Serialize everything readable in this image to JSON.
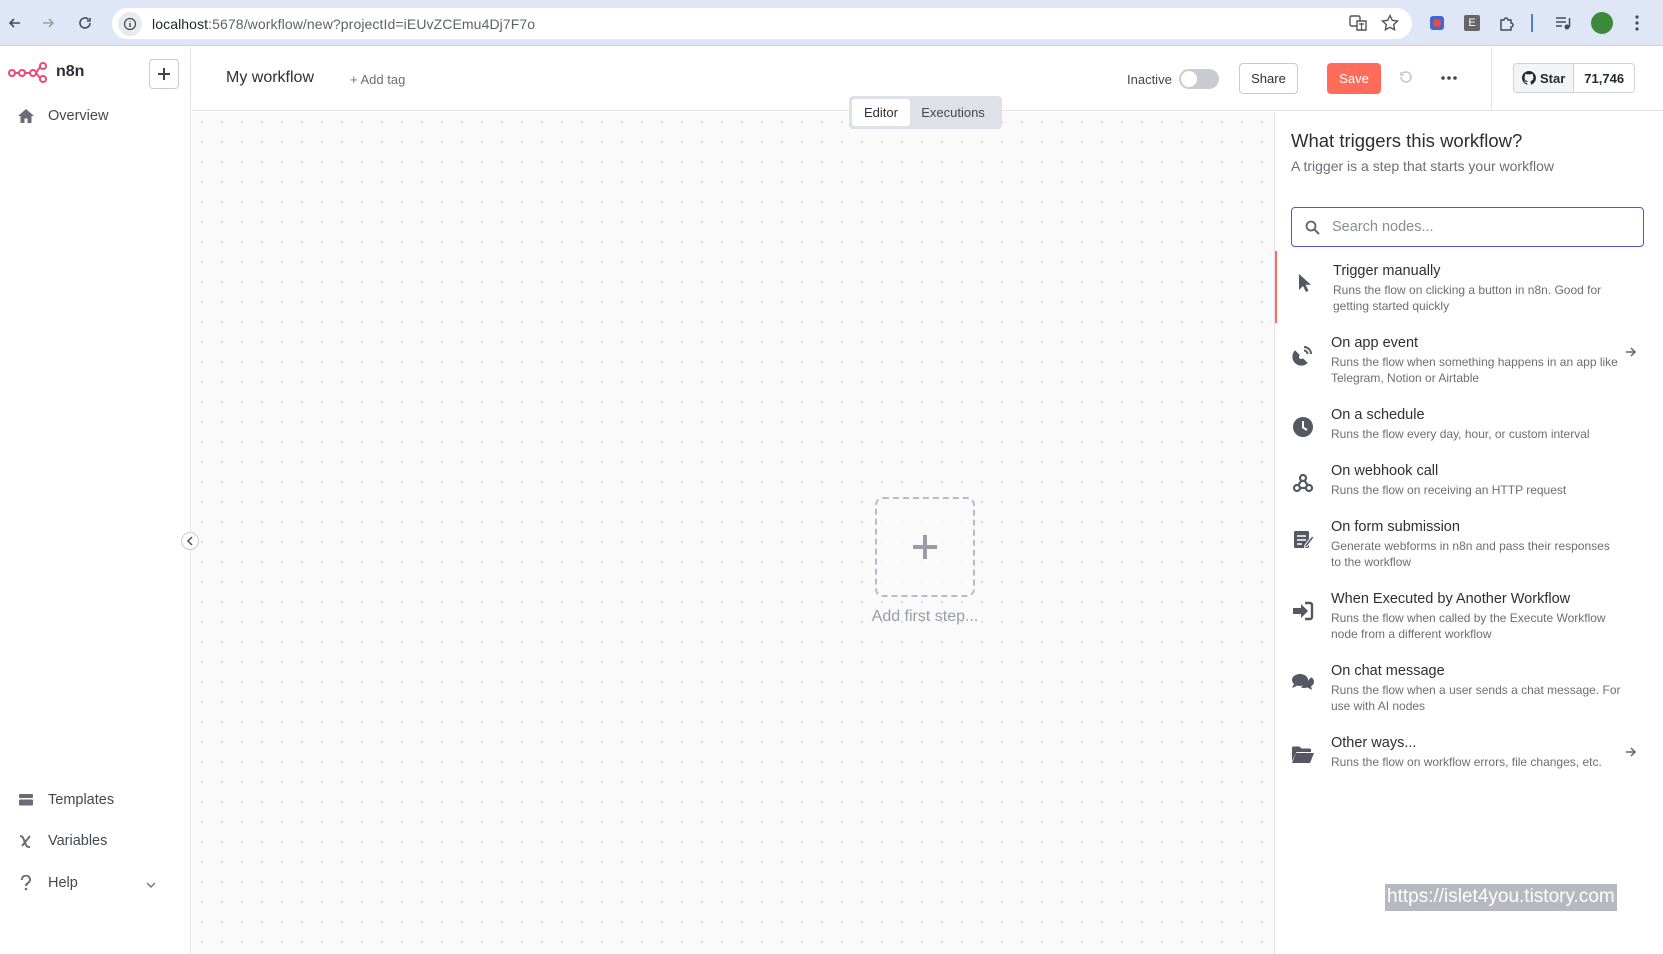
{
  "browser": {
    "url_host": "localhost",
    "url_rest": ":5678/workflow/new?projectId=iEUvZCEmu4Dj7F7o",
    "ext_e_label": "E"
  },
  "sidebar": {
    "logo_text": "n8n",
    "items_top": [
      {
        "label": "Overview",
        "icon": "home-icon"
      }
    ],
    "items_bottom": [
      {
        "label": "Templates",
        "icon": "templates-icon"
      },
      {
        "label": "Variables",
        "icon": "variables-icon"
      },
      {
        "label": "Help",
        "icon": "help-icon"
      }
    ]
  },
  "header": {
    "workflow_name": "My workflow",
    "add_tag": "+ Add tag",
    "status_label": "Inactive",
    "share_label": "Share",
    "save_label": "Save",
    "github_star_label": "Star",
    "github_star_count": "71,746"
  },
  "tabs": [
    {
      "label": "Editor",
      "active": true
    },
    {
      "label": "Executions",
      "active": false
    }
  ],
  "canvas": {
    "add_first_step_label": "Add first step..."
  },
  "panel": {
    "title": "What triggers this workflow?",
    "subtitle": "A trigger is a step that starts your workflow",
    "search_placeholder": "Search nodes...",
    "items": [
      {
        "name": "Trigger manually",
        "desc": "Runs the flow on clicking a button in n8n. Good for getting started quickly",
        "icon": "cursor-icon",
        "selected": true,
        "arrow": false
      },
      {
        "name": "On app event",
        "desc": "Runs the flow when something happens in an app like Telegram, Notion or Airtable",
        "icon": "satellite-dish-icon",
        "selected": false,
        "arrow": true
      },
      {
        "name": "On a schedule",
        "desc": "Runs the flow every day, hour, or custom interval",
        "icon": "clock-icon",
        "selected": false,
        "arrow": false
      },
      {
        "name": "On webhook call",
        "desc": "Runs the flow on receiving an HTTP request",
        "icon": "webhook-icon",
        "selected": false,
        "arrow": false
      },
      {
        "name": "On form submission",
        "desc": "Generate webforms in n8n and pass their responses to the workflow",
        "icon": "form-icon",
        "selected": false,
        "arrow": false
      },
      {
        "name": "When Executed by Another Workflow",
        "desc": "Runs the flow when called by the Execute Workflow node from a different workflow",
        "icon": "sign-in-icon",
        "selected": false,
        "arrow": false
      },
      {
        "name": "On chat message",
        "desc": "Runs the flow when a user sends a chat message. For use with AI nodes",
        "icon": "chat-icon",
        "selected": false,
        "arrow": false
      },
      {
        "name": "Other ways...",
        "desc": "Runs the flow on workflow errors, file changes, etc.",
        "icon": "folder-open-icon",
        "selected": false,
        "arrow": true
      }
    ]
  },
  "watermark": "https://islet4you.tistory.com",
  "colors": {
    "accent": "#ff6d5a",
    "primary": "#5b4ee3"
  }
}
